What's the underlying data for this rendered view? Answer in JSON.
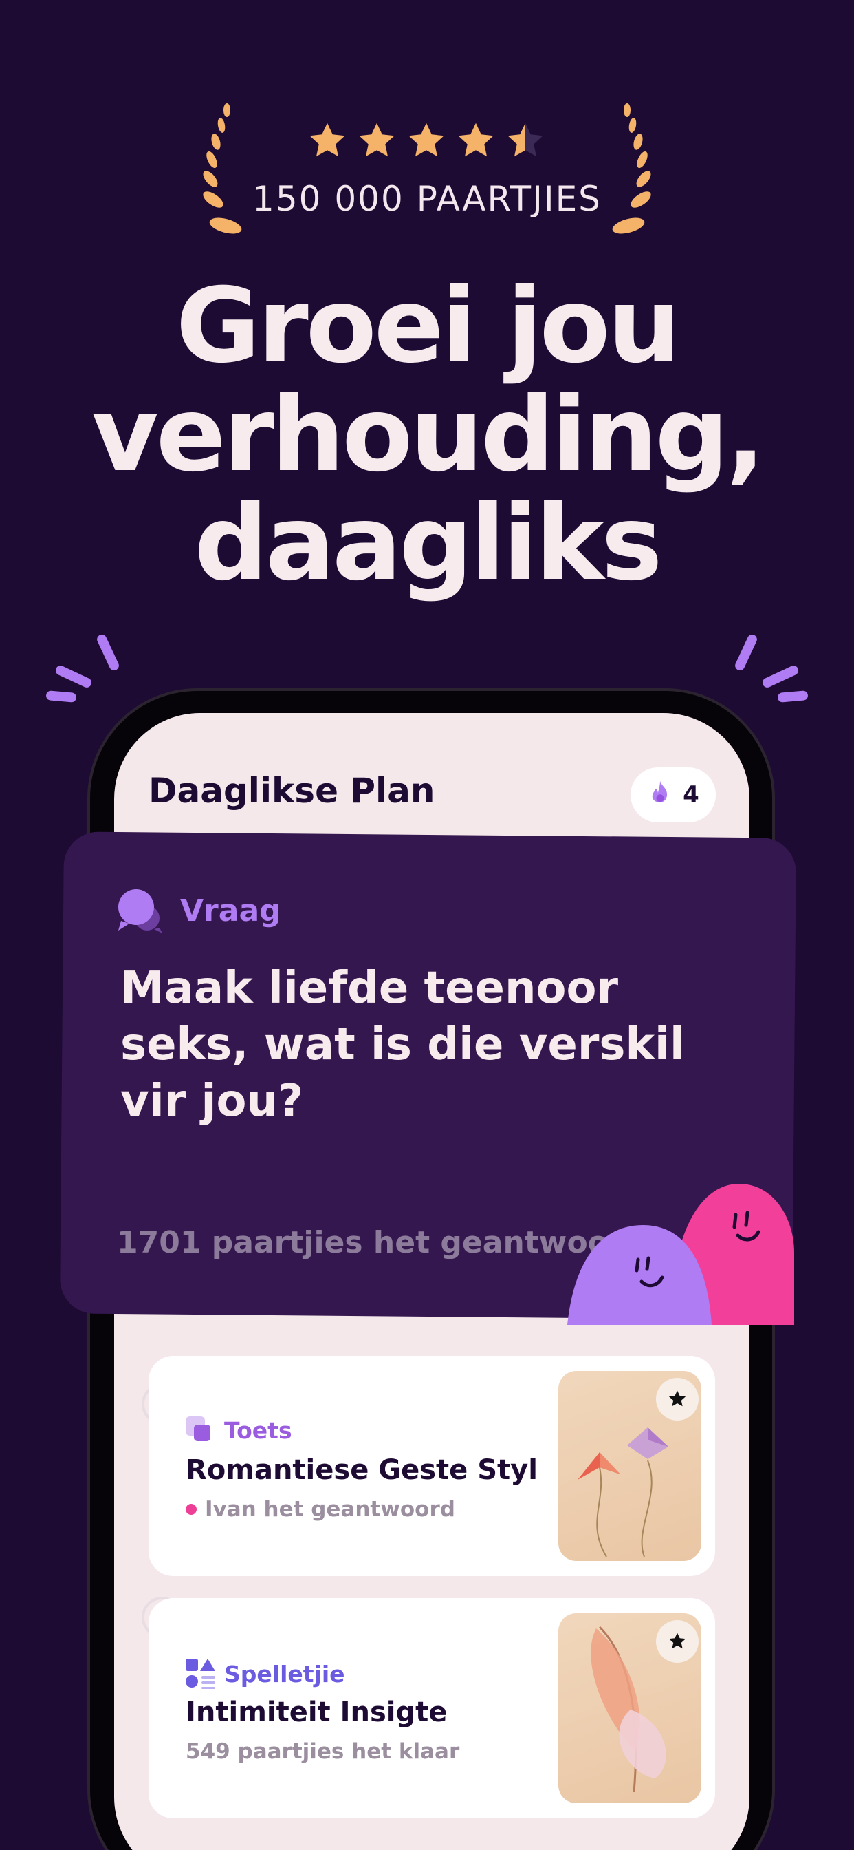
{
  "rating": {
    "stars": 4.5,
    "reviews_label": "150 000 PAARTJIES"
  },
  "headline": {
    "line1": "Groei jou",
    "line2": "verhouding,",
    "line3": "daagliks"
  },
  "app": {
    "plan_title": "Daaglikse Plan",
    "streak_count": "4"
  },
  "question_card": {
    "type_label": "Vraag",
    "question": "Maak liefde teenoor seks, wat is die verskil vir jou?",
    "answered_text": "1701 paartjies het geantwoord"
  },
  "activities": [
    {
      "type_label": "Toets",
      "type_color": "#9b5de0",
      "title": "Romantiese Geste Styl",
      "subtitle": "Ivan het geantwoord",
      "favorite": true
    },
    {
      "type_label": "Spelletjie",
      "type_color": "#6a5be0",
      "title": "Intimiteit Insigte",
      "subtitle": "549 paartjies het klaar",
      "favorite": true
    }
  ],
  "colors": {
    "background": "#1d0b33",
    "card": "#35174f",
    "accent_purple": "#b07cf3",
    "accent_pink": "#ec3f95",
    "star_gold": "#f5b36a"
  }
}
